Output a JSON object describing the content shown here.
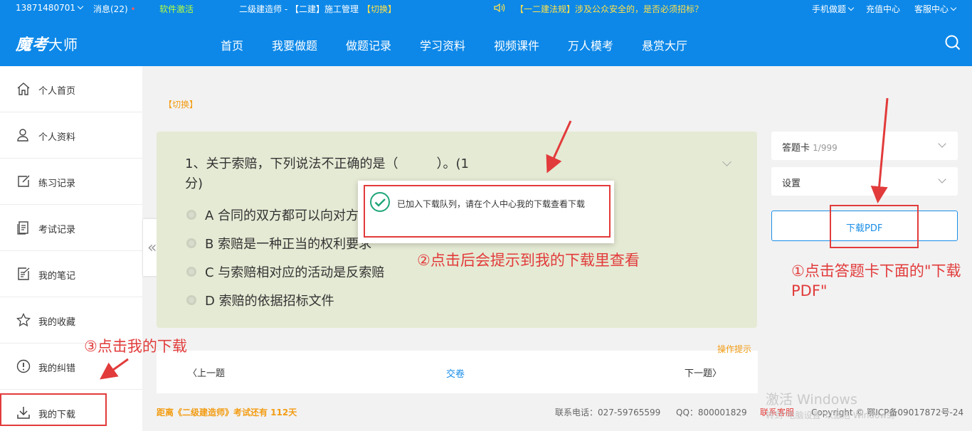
{
  "topbar": {
    "phone": "13871480701",
    "messages": "消息(22)",
    "activate": "软件激活",
    "exam": "二级建造师 - 【二建】施工管理",
    "switch": "【切换】",
    "notice": "【一二建法规】涉及公众安全的，是否必须招标？",
    "mobile": "手机做题",
    "recharge": "充值中心",
    "service": "客服中心"
  },
  "nav": {
    "logo_italic": "魔考",
    "logo_rest": "大师",
    "items": [
      "首页",
      "我要做题",
      "做题记录",
      "学习资料",
      "视频课件",
      "万人模考",
      "悬赏大厅"
    ]
  },
  "sidebar": {
    "items": [
      {
        "label": "个人首页",
        "icon": "home-icon"
      },
      {
        "label": "个人资料",
        "icon": "user-icon"
      },
      {
        "label": "练习记录",
        "icon": "edit-icon"
      },
      {
        "label": "考试记录",
        "icon": "doc-icon"
      },
      {
        "label": "我的笔记",
        "icon": "note-icon"
      },
      {
        "label": "我的收藏",
        "icon": "star-icon"
      },
      {
        "label": "我的纠错",
        "icon": "alert-icon"
      },
      {
        "label": "我的下载",
        "icon": "download-icon"
      }
    ]
  },
  "main": {
    "switch": "【切换】",
    "question": "1、关于索赔，下列说法不正确的是（　　　）。(1分)",
    "options": [
      "A 合同的双方都可以向对方提出索赔",
      "B 索赔是一种正当的权利要求",
      "C 与索赔相对应的活动是反索赔",
      "D 索赔的依据招标文件"
    ],
    "toast": "已加入下载队列，请在个人中心我的下载查看下载",
    "prev": "上一题",
    "submit": "交卷",
    "next": "下一题",
    "op_tip": "操作提示"
  },
  "right": {
    "answer_card": "答题卡",
    "answer_count": "1/999",
    "settings": "设置",
    "download_pdf": "下载PDF"
  },
  "footer": {
    "countdown": "距离《二级建造师》考试还有 112天",
    "phone": "联系电话：027-59765599",
    "qq": "QQ：800001829",
    "contact": "联系客服",
    "copyright": "Copyright © 鄂ICP备09017872号-24"
  },
  "annotations": {
    "step1": "①点击答题卡下面的\"下载PDF\"",
    "step2": "②点击后会提示到我的下载里查看",
    "step3": "③点击我的下载"
  },
  "watermark": {
    "title": "激活 Windows",
    "sub": "转到\"电脑设置\"以激活 Windows。"
  },
  "colors": {
    "brand": "#0d88e8",
    "highlight": "#e23b3b",
    "accent_orange": "#f39c12"
  }
}
